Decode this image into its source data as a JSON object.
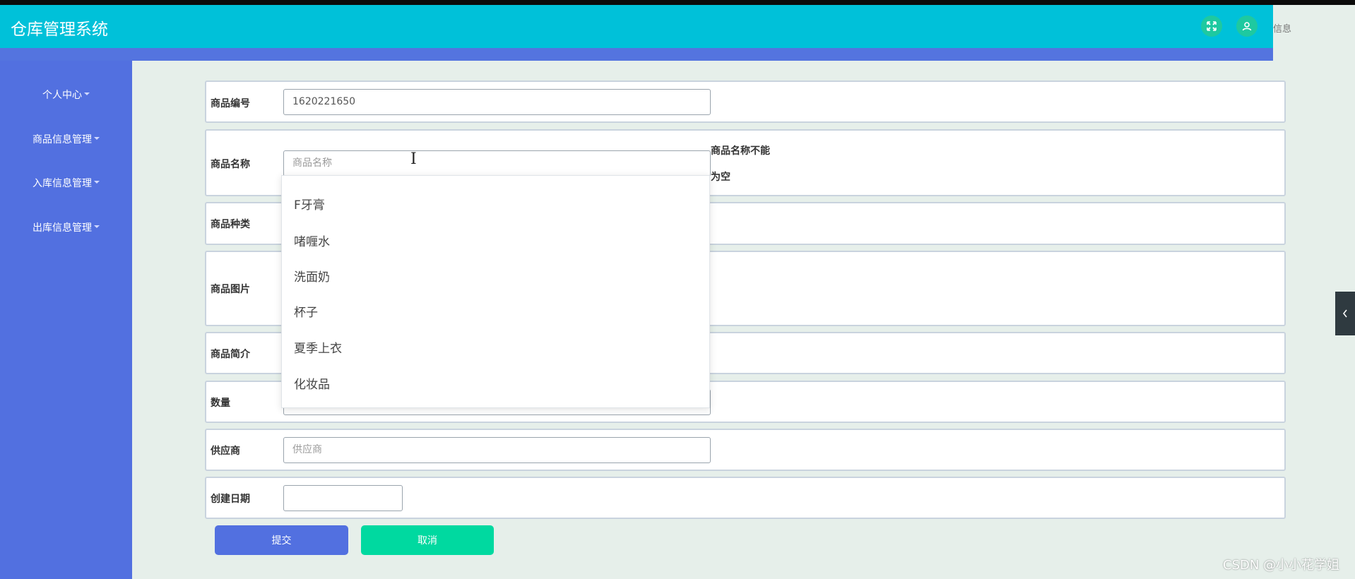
{
  "app": {
    "title": "仓库管理系统",
    "header_right_text": "信息"
  },
  "colors": {
    "header": "#00c1d9",
    "sidebar": "#5270e0",
    "submit": "#5270e0",
    "cancel": "#00d9a0",
    "header_buttons": "#1ec9a0"
  },
  "header": {
    "icons": [
      "fullscreen-icon",
      "user-icon"
    ]
  },
  "sidebar": {
    "items": [
      {
        "label": "个人中心"
      },
      {
        "label": "商品信息管理"
      },
      {
        "label": "入库信息管理"
      },
      {
        "label": "出库信息管理"
      }
    ]
  },
  "form": {
    "product_code": {
      "label": "商品编号",
      "value": "1620221650"
    },
    "product_name": {
      "label": "商品名称",
      "placeholder": "商品名称",
      "error_line1": "商品名称不能",
      "error_line2": "为空"
    },
    "product_category": {
      "label": "商品种类"
    },
    "product_image": {
      "label": "商品图片"
    },
    "product_intro": {
      "label": "商品简介"
    },
    "quantity": {
      "label": "数量"
    },
    "supplier": {
      "label": "供应商",
      "placeholder": "供应商"
    },
    "created_date": {
      "label": "创建日期",
      "value": ""
    }
  },
  "dropdown": {
    "options": [
      "F牙膏",
      "啫喱水",
      "洗面奶",
      "杯子",
      "夏季上衣",
      "化妆品"
    ]
  },
  "buttons": {
    "submit": "提交",
    "cancel": "取消"
  },
  "watermark": "CSDN @小小花学姐"
}
